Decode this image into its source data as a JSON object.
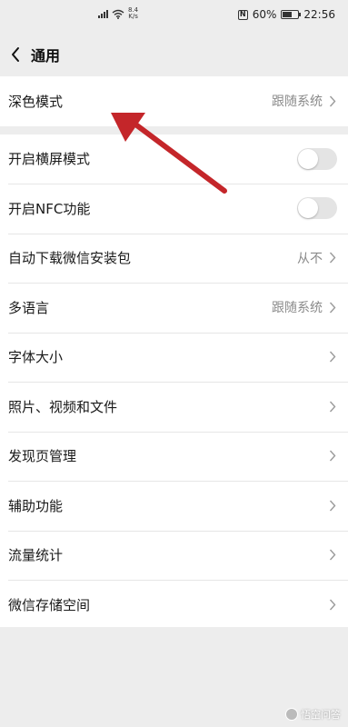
{
  "status_bar": {
    "net_speed_value": "8.4",
    "net_speed_unit": "K/s",
    "nfc_symbol": "N",
    "battery_percent": "60%",
    "battery_level": 0.6,
    "time": "22:56"
  },
  "header": {
    "back_icon": "chevron-left-icon",
    "title": "通用"
  },
  "settings": {
    "dark_mode": {
      "label": "深色模式",
      "value": "跟随系统"
    },
    "landscape": {
      "label": "开启横屏模式",
      "on": false
    },
    "nfc": {
      "label": "开启NFC功能",
      "on": false
    },
    "auto_download": {
      "label": "自动下载微信安装包",
      "value": "从不"
    },
    "language": {
      "label": "多语言",
      "value": "跟随系统"
    },
    "font_size": {
      "label": "字体大小"
    },
    "media": {
      "label": "照片、视频和文件"
    },
    "discover": {
      "label": "发现页管理"
    },
    "accessibility": {
      "label": "辅助功能"
    },
    "traffic": {
      "label": "流量统计"
    },
    "storage": {
      "label": "微信存储空间"
    }
  },
  "annotation": {
    "arrow_color": "#c4262a"
  },
  "watermark": {
    "text": "悟空问答"
  }
}
